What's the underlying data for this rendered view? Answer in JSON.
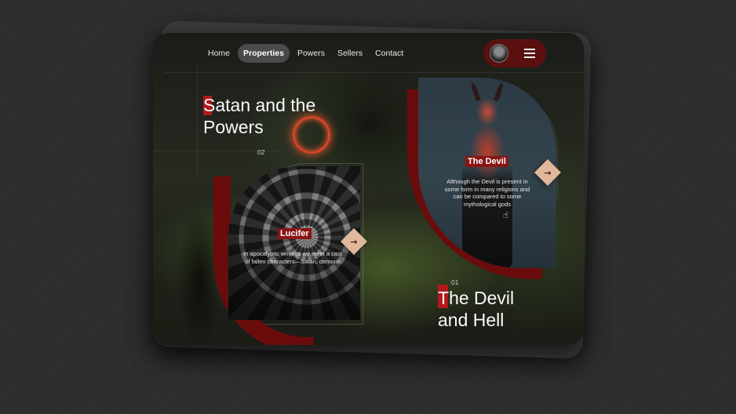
{
  "nav": {
    "items": [
      {
        "label": "Home",
        "active": false
      },
      {
        "label": "Properties",
        "active": true
      },
      {
        "label": "Powers",
        "active": false
      },
      {
        "label": "Sellers",
        "active": false
      },
      {
        "label": "Contact",
        "active": false
      }
    ]
  },
  "hero": {
    "title_first": "S",
    "title_rest": "atan and the",
    "title_line2": "Powers",
    "number": "02"
  },
  "cards": {
    "lucifer": {
      "label": "Lucifer",
      "description": "In apocalyptic writings we meet a cast of fallen characters—Satan, demons",
      "arrow": "→"
    },
    "devil": {
      "label": "The Devil",
      "description": "Although the Devil is present in some form in many religions and can be compared to some mythological gods",
      "arrow": "→"
    }
  },
  "section2": {
    "number": "01",
    "title_first": "T",
    "title_rest": "he Devil",
    "title_line2": "and Hell"
  },
  "icons": {
    "menu": "hamburger-icon",
    "avatar": "avatar",
    "arrow": "arrow-right-icon",
    "cursor": "hand-pointer-icon"
  },
  "colors": {
    "accent_red": "#8a1414",
    "dark_red": "#6a0c0c",
    "arrow_button": "#e0b89b"
  }
}
